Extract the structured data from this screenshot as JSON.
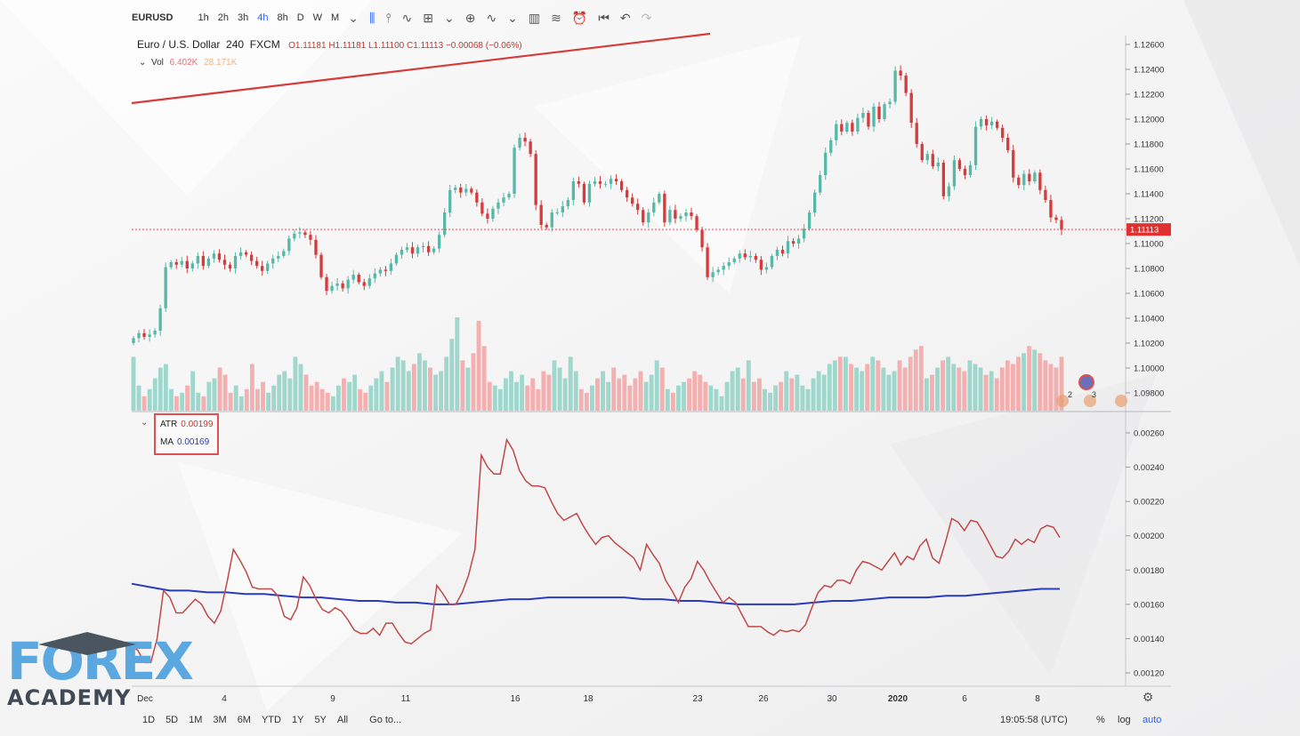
{
  "toolbar": {
    "symbol": "EURUSD",
    "intervals": [
      "1h",
      "2h",
      "3h",
      "4h",
      "8h",
      "D",
      "W",
      "M"
    ],
    "active_interval": "4h"
  },
  "legend": {
    "name": "Euro / U.S. Dollar",
    "interval": "240",
    "source": "FXCM",
    "o": "O1.11181",
    "h": "H1.11181",
    "l": "L1.11100",
    "c": "C1.11113",
    "change": "−0.00068 (−0.06%)"
  },
  "vol_legend": {
    "label": "Vol",
    "v1": "6.402K",
    "v2": "28.171K"
  },
  "atr_legend": {
    "atr_label": "ATR",
    "atr_value": "0.00199",
    "ma_label": "MA",
    "ma_value": "0.00169"
  },
  "price_badge": "1.11113",
  "bottom_bar": {
    "ranges": [
      "1D",
      "5D",
      "1M",
      "3M",
      "6M",
      "YTD",
      "1Y",
      "5Y",
      "All"
    ],
    "goto": "Go to...",
    "time": "19:05:58 (UTC)",
    "pct": "%",
    "log": "log",
    "auto": "auto"
  },
  "logo": {
    "line1": "FOREX",
    "line2": "ACADEMY"
  },
  "colors": {
    "up": "#56b9a8",
    "down": "#d63a3a",
    "vol_up": "#8fd1c4",
    "vol_down": "#f2a3a3",
    "atr": "#c04848",
    "ma": "#2a3bbd",
    "price_line": "#e05050"
  },
  "chart_data": [
    {
      "type": "candlestick",
      "title": "Euro / U.S. Dollar 240 FXCM",
      "x_tick_labels": [
        "Dec",
        "4",
        "9",
        "11",
        "16",
        "18",
        "23",
        "26",
        "30",
        "2020",
        "6",
        "8"
      ],
      "ylim": [
        1.097,
        1.127
      ],
      "y_ticks": [
        "1.12600",
        "1.12400",
        "1.12200",
        "1.12000",
        "1.11800",
        "1.11600",
        "1.11400",
        "1.11200",
        "1.11000",
        "1.10800",
        "1.10600",
        "1.10400",
        "1.10200",
        "1.10000",
        "1.09800"
      ],
      "last_price": 1.11113,
      "trendline": [
        [
          1.1212,
          "start"
        ],
        [
          1.1267,
          "end"
        ]
      ],
      "close": [
        1.1024,
        1.1028,
        1.1025,
        1.1027,
        1.103,
        1.1048,
        1.1081,
        1.1085,
        1.1083,
        1.1086,
        1.108,
        1.1084,
        1.109,
        1.1082,
        1.1088,
        1.1092,
        1.1087,
        1.1083,
        1.108,
        1.109,
        1.1093,
        1.1091,
        1.1086,
        1.1082,
        1.1078,
        1.1084,
        1.1088,
        1.109,
        1.1094,
        1.1104,
        1.1108,
        1.1109,
        1.1107,
        1.1103,
        1.1091,
        1.1073,
        1.1062,
        1.1066,
        1.1068,
        1.1064,
        1.1071,
        1.1075,
        1.1069,
        1.1066,
        1.1072,
        1.1076,
        1.1079,
        1.1078,
        1.1084,
        1.1091,
        1.1095,
        1.1097,
        1.1092,
        1.1097,
        1.1098,
        1.1093,
        1.1096,
        1.1107,
        1.1125,
        1.1143,
        1.1145,
        1.1141,
        1.1144,
        1.1141,
        1.1133,
        1.1124,
        1.112,
        1.1128,
        1.1133,
        1.1137,
        1.114,
        1.1177,
        1.1185,
        1.1182,
        1.1172,
        1.1131,
        1.1115,
        1.1113,
        1.1125,
        1.1125,
        1.113,
        1.1135,
        1.115,
        1.1148,
        1.1133,
        1.1148,
        1.115,
        1.1148,
        1.1148,
        1.1152,
        1.115,
        1.1143,
        1.1137,
        1.1132,
        1.1127,
        1.1117,
        1.1125,
        1.1133,
        1.114,
        1.1117,
        1.1127,
        1.112,
        1.1122,
        1.1125,
        1.1122,
        1.1111,
        1.1097,
        1.1073,
        1.1077,
        1.1079,
        1.1082,
        1.1085,
        1.1088,
        1.1092,
        1.1089,
        1.109,
        1.1087,
        1.1079,
        1.1081,
        1.109,
        1.1095,
        1.1092,
        1.1102,
        1.11,
        1.1104,
        1.1112,
        1.1125,
        1.1141,
        1.1155,
        1.1173,
        1.1183,
        1.1196,
        1.119,
        1.1197,
        1.119,
        1.1201,
        1.1205,
        1.1194,
        1.121,
        1.12,
        1.1212,
        1.1214,
        1.1239,
        1.1235,
        1.1221,
        1.1197,
        1.118,
        1.1167,
        1.1172,
        1.1162,
        1.1165,
        1.1138,
        1.1146,
        1.1167,
        1.116,
        1.1155,
        1.1163,
        1.1194,
        1.12,
        1.1195,
        1.1198,
        1.1193,
        1.1185,
        1.1175,
        1.1153,
        1.1147,
        1.1156,
        1.115,
        1.1157,
        1.1143,
        1.1135,
        1.1121,
        1.1119,
        1.1111
      ]
    },
    {
      "type": "bar",
      "title": "Vol",
      "values_k": [
        30,
        14,
        8,
        12,
        18,
        24,
        26,
        12,
        8,
        10,
        14,
        22,
        10,
        8,
        16,
        18,
        24,
        20,
        10,
        14,
        8,
        12,
        26,
        12,
        16,
        10,
        14,
        20,
        22,
        18,
        30,
        26,
        20,
        14,
        16,
        12,
        10,
        8,
        14,
        18,
        16,
        20,
        12,
        10,
        14,
        18,
        22,
        16,
        24,
        30,
        28,
        22,
        26,
        32,
        28,
        24,
        20,
        22,
        30,
        40,
        52,
        28,
        24,
        32,
        50,
        36,
        16,
        14,
        12,
        18,
        22,
        16,
        20,
        14,
        18,
        12,
        22,
        20,
        28,
        24,
        18,
        30,
        22,
        12,
        10,
        14,
        18,
        22,
        16,
        24,
        18,
        20,
        14,
        18,
        22,
        16,
        20,
        28,
        24,
        12,
        10,
        14,
        16,
        18,
        22,
        20,
        16,
        14,
        12,
        8,
        16,
        22,
        24,
        18,
        28,
        16,
        18,
        12,
        10,
        14,
        16,
        22,
        18,
        20,
        14,
        12,
        18,
        22,
        20,
        26,
        28,
        30,
        30,
        26,
        24,
        22,
        26,
        30,
        28,
        24,
        20,
        22,
        28,
        24,
        30,
        34,
        36,
        18,
        20,
        24,
        28,
        30,
        26,
        24,
        22,
        28,
        26,
        24,
        20,
        22,
        18,
        24,
        28,
        26,
        30,
        32,
        36,
        34,
        32,
        28,
        26,
        24,
        30
      ]
    },
    {
      "type": "line",
      "title": "ATR",
      "ylim": [
        0.0011,
        0.0027
      ],
      "y_ticks": [
        "0.00260",
        "0.00240",
        "0.00220",
        "0.00200",
        "0.00180",
        "0.00160",
        "0.00140",
        "0.00120"
      ],
      "series": [
        {
          "name": "ATR",
          "values": [
            0.00136,
            0.00133,
            0.00126,
            0.00126,
            0.0014,
            0.00168,
            0.00164,
            0.00155,
            0.00155,
            0.00159,
            0.00163,
            0.0016,
            0.00153,
            0.00149,
            0.00156,
            0.00173,
            0.00192,
            0.00186,
            0.00179,
            0.0017,
            0.00169,
            0.00169,
            0.00169,
            0.00165,
            0.00153,
            0.00151,
            0.00158,
            0.00176,
            0.00171,
            0.00163,
            0.00157,
            0.00155,
            0.00158,
            0.00156,
            0.00151,
            0.00145,
            0.00143,
            0.00143,
            0.00146,
            0.00142,
            0.00149,
            0.00149,
            0.00143,
            0.00138,
            0.00137,
            0.0014,
            0.00143,
            0.00145,
            0.00171,
            0.00166,
            0.0016,
            0.0016,
            0.00167,
            0.00177,
            0.00192,
            0.00247,
            0.0024,
            0.00236,
            0.00236,
            0.00256,
            0.0025,
            0.00238,
            0.00232,
            0.00229,
            0.00229,
            0.00228,
            0.0022,
            0.00213,
            0.00209,
            0.00211,
            0.00213,
            0.00206,
            0.002,
            0.00195,
            0.00199,
            0.002,
            0.00196,
            0.00193,
            0.0019,
            0.00187,
            0.0018,
            0.00195,
            0.00189,
            0.00184,
            0.00174,
            0.00168,
            0.00161,
            0.0017,
            0.00175,
            0.00185,
            0.0018,
            0.00173,
            0.00167,
            0.00161,
            0.00164,
            0.00161,
            0.00154,
            0.00147,
            0.00147,
            0.00147,
            0.00144,
            0.00142,
            0.00145,
            0.00144,
            0.00145,
            0.00144,
            0.00148,
            0.00158,
            0.00167,
            0.00171,
            0.0017,
            0.00174,
            0.00174,
            0.00172,
            0.0018,
            0.00185,
            0.00184,
            0.00182,
            0.0018,
            0.00185,
            0.0019,
            0.00183,
            0.00188,
            0.00186,
            0.00194,
            0.00198,
            0.00187,
            0.00184,
            0.00196,
            0.0021,
            0.00208,
            0.00203,
            0.00209,
            0.00208,
            0.00202,
            0.00195,
            0.00188,
            0.00187,
            0.00191,
            0.00198,
            0.00195,
            0.00198,
            0.00196,
            0.00204,
            0.00206,
            0.00205,
            0.00199
          ]
        },
        {
          "name": "MA",
          "values": [
            0.00172,
            0.0017,
            0.00168,
            0.00168,
            0.00167,
            0.00167,
            0.00166,
            0.00166,
            0.00165,
            0.00164,
            0.00164,
            0.00163,
            0.00162,
            0.00162,
            0.00161,
            0.00161,
            0.0016,
            0.0016,
            0.00161,
            0.00162,
            0.00163,
            0.00163,
            0.00164,
            0.00164,
            0.00164,
            0.00164,
            0.00164,
            0.00163,
            0.00163,
            0.00162,
            0.00162,
            0.00161,
            0.0016,
            0.0016,
            0.0016,
            0.0016,
            0.00161,
            0.00162,
            0.00162,
            0.00163,
            0.00164,
            0.00164,
            0.00164,
            0.00165,
            0.00165,
            0.00166,
            0.00167,
            0.00168,
            0.00169,
            0.00169
          ]
        }
      ]
    }
  ]
}
